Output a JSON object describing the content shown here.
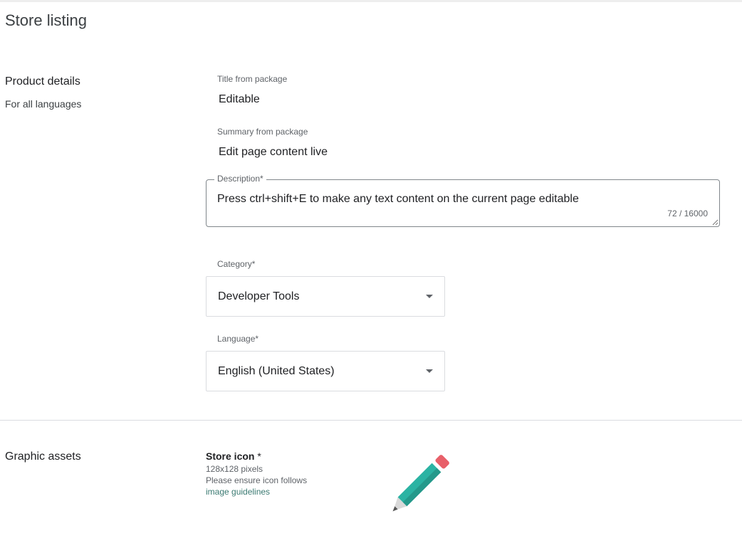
{
  "page": {
    "title": "Store listing"
  },
  "product_details": {
    "heading": "Product details",
    "subheading": "For all languages",
    "title_label": "Title from package",
    "title_value": "Editable",
    "summary_label": "Summary from package",
    "summary_value": "Edit page content live",
    "description": {
      "label": "Description*",
      "value": "Press ctrl+shift+E to make any text content on the current page editable",
      "counter": "72 / 16000"
    },
    "category": {
      "label": "Category*",
      "selected": "Developer Tools"
    },
    "language": {
      "label": "Language*",
      "selected": "English (United States)"
    }
  },
  "graphic_assets": {
    "heading": "Graphic assets",
    "store_icon_title": "Store icon",
    "store_icon_required": " *",
    "store_icon_size": "128x128 pixels",
    "store_icon_note": "Please ensure icon follows",
    "guidelines_link": "image guidelines",
    "icon_name": "pencil-icon",
    "colors": {
      "pencil_body": "#2bb3a3",
      "pencil_body_dark": "#25998b",
      "pencil_eraser": "#e8606a",
      "pencil_ferrule": "#ffffff",
      "pencil_tip": "#d9d9d9",
      "pencil_lead": "#555555"
    }
  }
}
